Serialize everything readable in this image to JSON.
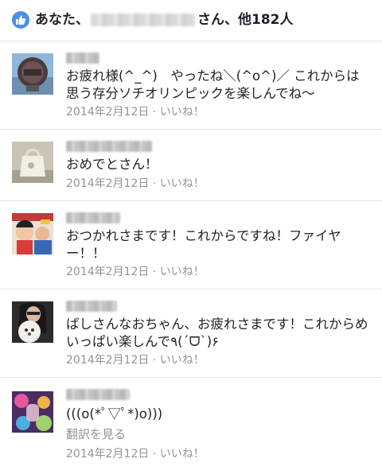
{
  "header": {
    "prefix": "あなた、",
    "suffix": "さん、他182人"
  },
  "comments": [
    {
      "text": "お疲れ様(^_^)　やったね＼(^o^)／ これからは思う存分ソチオリンピックを楽しんでね〜",
      "date": "2014年2月12日",
      "sep": " · ",
      "like": "いいね！"
    },
    {
      "text": "おめでとさん！",
      "date": "2014年2月12日",
      "sep": " · ",
      "like": "いいね！"
    },
    {
      "text": "おつかれさまです！これからですね！ファイヤー！！",
      "date": "2014年2月12日",
      "sep": " · ",
      "like": "いいね！"
    },
    {
      "text": "ばしさんなおちゃん、お疲れさまです！これからめいっぱい楽しんで٩(ˊᗜˋ)۶",
      "date": "2014年2月12日",
      "sep": " · ",
      "like": "いいね！"
    },
    {
      "text": "(((o(*ﾟ▽ﾟ*)o)))",
      "translate": "翻訳を見る",
      "date": "2014年2月12日",
      "sep": " · ",
      "like": "いいね！"
    }
  ]
}
